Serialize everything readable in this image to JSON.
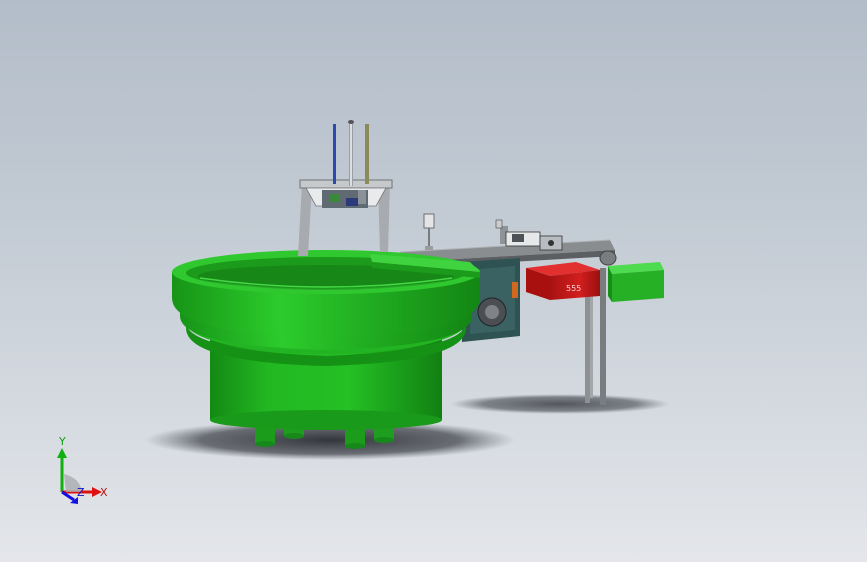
{
  "window": {
    "title": ""
  },
  "model": {
    "colors": {
      "bowl": "#23b823",
      "bowl_dark": "#168a16",
      "bowl_light": "#3fd43f",
      "bin_red": "#c81a1a",
      "bin_green": "#2bbf2b",
      "frame": "#3a5a5a",
      "rail": "#7a7a7a"
    },
    "bin_label": "555"
  },
  "triad": {
    "y_label": "Y",
    "x_label": "X",
    "z_label": "Z",
    "colors": {
      "x": "#e01010",
      "y": "#10b010",
      "z": "#1010e0"
    }
  }
}
